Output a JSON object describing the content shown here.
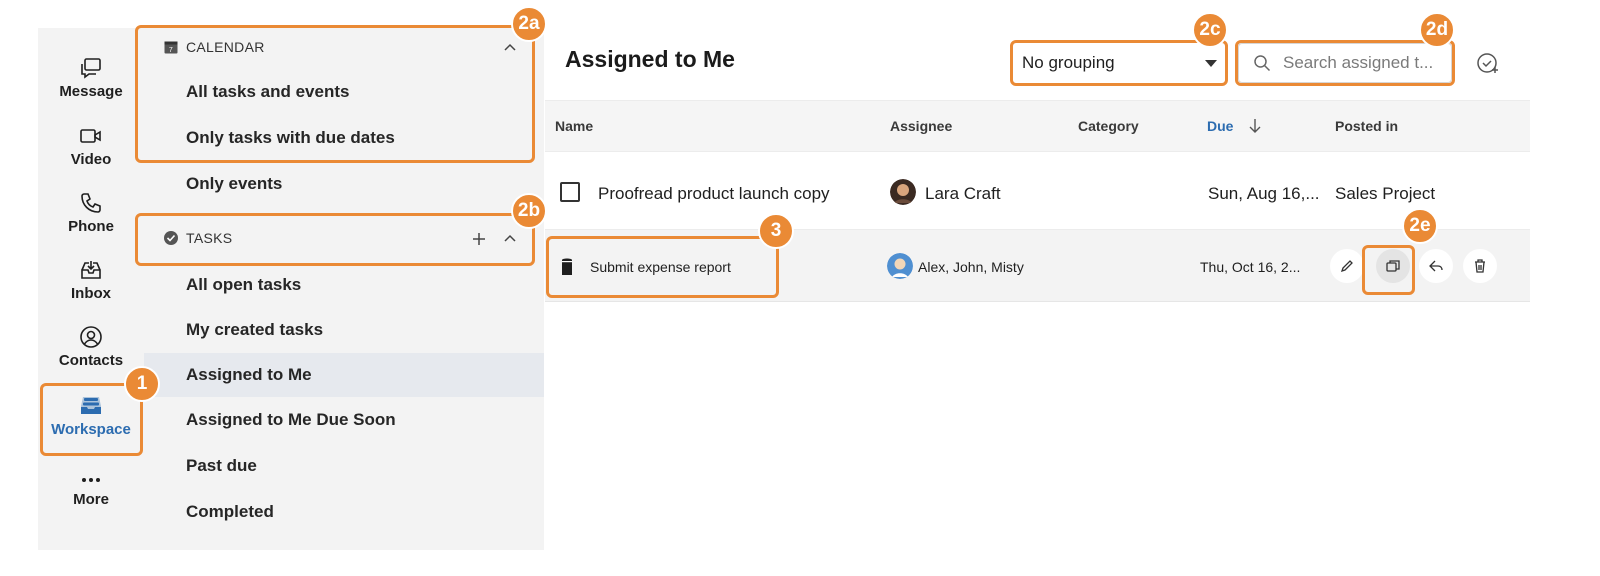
{
  "rail": {
    "items": [
      {
        "label": "Message",
        "icon": "message-icon"
      },
      {
        "label": "Video",
        "icon": "video-icon"
      },
      {
        "label": "Phone",
        "icon": "phone-icon"
      },
      {
        "label": "Inbox",
        "icon": "inbox-icon"
      },
      {
        "label": "Contacts",
        "icon": "contacts-icon"
      },
      {
        "label": "Workspace",
        "icon": "workspace-icon",
        "active": true
      },
      {
        "label": "More",
        "icon": "more-icon"
      }
    ]
  },
  "nav": {
    "calendar_header": "CALENDAR",
    "calendar_items": [
      "All tasks and events",
      "Only tasks with due dates",
      "Only events"
    ],
    "tasks_header": "TASKS",
    "task_items": [
      "All open tasks",
      "My created tasks",
      "Assigned to Me",
      "Assigned to Me Due Soon",
      "Past due",
      "Completed"
    ],
    "active_item": "Assigned to Me"
  },
  "main": {
    "title": "Assigned to Me",
    "grouping_value": "No grouping",
    "search_placeholder": "Search assigned t..."
  },
  "table": {
    "columns": {
      "name": "Name",
      "assignee": "Assignee",
      "category": "Category",
      "due": "Due",
      "posted_in": "Posted in"
    },
    "rows": [
      {
        "name": "Proofread product launch copy",
        "assignee": "Lara Craft",
        "category": "",
        "due": "Sun, Aug 16,...",
        "posted_in": "Sales Project"
      },
      {
        "name": "Submit expense report",
        "assignee": "Alex, John, Misty",
        "category": "",
        "due": "Thu, Oct 16, 2...",
        "posted_in": ""
      }
    ]
  },
  "callouts": {
    "c1": "1",
    "c2a": "2a",
    "c2b": "2b",
    "c2c": "2c",
    "c2d": "2d",
    "c2e": "2e",
    "c3": "3"
  },
  "colors": {
    "accent": "#2c6cb0",
    "callout": "#ea8a35",
    "active_nav": "#e6e9ee"
  }
}
